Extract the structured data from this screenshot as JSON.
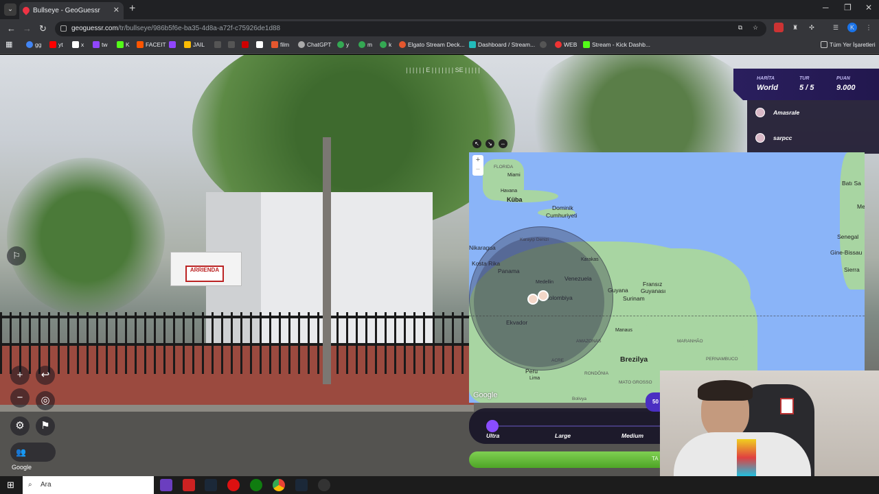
{
  "browser": {
    "tab_title": "Bullseye - GeoGuessr",
    "url_host": "geoguessr.com",
    "url_path": "/tr/bullseye/986b5f6e-ba35-4d8a-a72f-c75926de1d88",
    "bookmarks": [
      "gg",
      "yt",
      "x",
      "tw",
      "K",
      "FACEIT",
      "",
      "JAIL",
      "film",
      "ChatGPT",
      "y",
      "m",
      "k",
      "Elgato Stream Deck...",
      "Dashboard / Stream...",
      "WEB",
      "Stream - Kick Dashb..."
    ],
    "all_bookmarks_label": "Tüm Yer İşaretleri"
  },
  "streetview": {
    "compass_labels": [
      "E",
      "SE"
    ],
    "sign_text": "ARRIENDA",
    "google_label": "Google"
  },
  "hud": {
    "map_label": "HARİTA",
    "map_value": "World",
    "round_label": "TUR",
    "round_value": "5 / 5",
    "score_label": "PUAN",
    "score_value": "9.000"
  },
  "players": [
    "Amasrale",
    "sarpcc"
  ],
  "map": {
    "labels": {
      "florida": "FLORIDA",
      "miami": "Miami",
      "havana": "Havana",
      "cuba": "Küba",
      "dominik": "Dominik",
      "cumhuriyeti": "Cumhuriyeti",
      "nicaragua": "Nikaragua",
      "costarica": "Kosta Rika",
      "panama": "Panama",
      "caracas": "Karakas",
      "venezuela": "Venezuela",
      "medellin": "Medellin",
      "colombia": "Kolombiya",
      "ecuador": "Ekvador",
      "guyana": "Guyana",
      "suriname": "Surinam",
      "frguiana1": "Fransız",
      "frguiana2": "Guyanası",
      "manaus": "Manaus",
      "brazil": "Brezilya",
      "peru": "Peru",
      "lima": "Lima",
      "bati": "Batı Sa",
      "me": "Me",
      "senegal": "Senegal",
      "guinea": "Gine-Bissau",
      "sierra": "Sierra",
      "caribbean": "Karayip Denizi",
      "amazonas": "AMAZONAS",
      "acre": "ACRE",
      "rondonia": "RONDÔNIA",
      "matogrosso": "MATO GROSSO",
      "maranhao": "MARANHÃO",
      "pernambuco": "PERNAMBUCO",
      "bolivia": "Bolivya",
      "google": "Google"
    }
  },
  "size": {
    "options": [
      "Ultra",
      "Large",
      "Medium"
    ],
    "badge": "50"
  },
  "guess_button": "TA",
  "taskbar": {
    "search_placeholder": "Ara"
  }
}
